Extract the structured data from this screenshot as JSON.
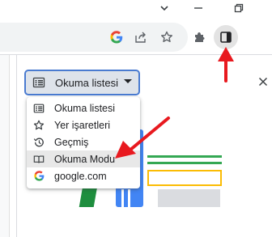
{
  "window_controls": {
    "chevron": "chevron-down-icon",
    "minimize": "minimize-icon",
    "restore": "restore-icon"
  },
  "toolbar": {
    "icons": [
      "google-icon",
      "share-icon",
      "bookmark-star-icon",
      "extensions-puzzle-icon",
      "side-panel-icon"
    ]
  },
  "side_panel": {
    "dropdown": {
      "selected_label": "Okuma listesi"
    },
    "menu": {
      "items": [
        {
          "label": "Okuma listesi",
          "icon": "reading-list-icon"
        },
        {
          "label": "Yer işaretleri",
          "icon": "bookmark-star-icon"
        },
        {
          "label": "Geçmiş",
          "icon": "history-icon"
        },
        {
          "label": "Okuma Modu",
          "icon": "reading-mode-book-icon"
        },
        {
          "label": "google.com",
          "icon": "google-icon"
        }
      ]
    }
  },
  "colors": {
    "accent_blue": "#4a7bd0",
    "annotation_red": "#e8191f",
    "dropdown_bg": "#dee3ea"
  }
}
